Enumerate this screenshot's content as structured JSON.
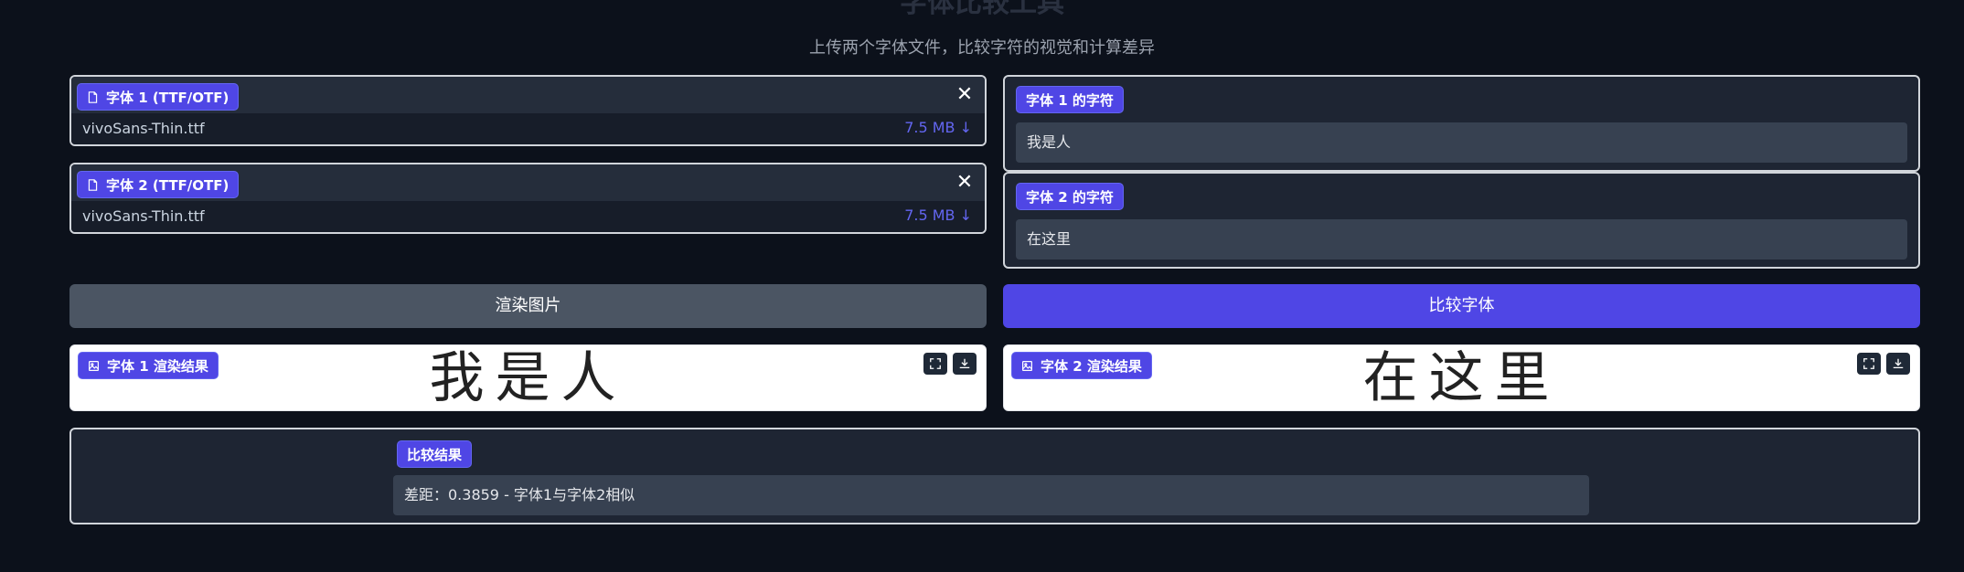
{
  "header": {
    "title": "字体比较工具",
    "subtitle": "上传两个字体文件，比较字符的视觉和计算差异"
  },
  "font1_upload": {
    "label": "字体 1 (TTF/OTF)",
    "file_name": "vivoSans-Thin.ttf",
    "file_size": "7.5 MB ↓",
    "close": "✕"
  },
  "font2_upload": {
    "label": "字体 2 (TTF/OTF)",
    "file_name": "vivoSans-Thin.ttf",
    "file_size": "7.5 MB ↓",
    "close": "✕"
  },
  "font1_chars": {
    "label": "字体 1 的字符",
    "value": "我是人"
  },
  "font2_chars": {
    "label": "字体 2 的字符",
    "value": "在这里"
  },
  "buttons": {
    "render": "渲染图片",
    "compare": "比较字体"
  },
  "render1": {
    "label": "字体 1 渲染结果",
    "glyphs": "我是人"
  },
  "render2": {
    "label": "字体 2 渲染结果",
    "glyphs": "在这里"
  },
  "comparison": {
    "label": "比较结果",
    "text": "差距：0.3859 - 字体1与字体2相似"
  },
  "colors": {
    "accent": "#4f46e5",
    "background": "#0c111b",
    "panel": "#1e2533"
  }
}
